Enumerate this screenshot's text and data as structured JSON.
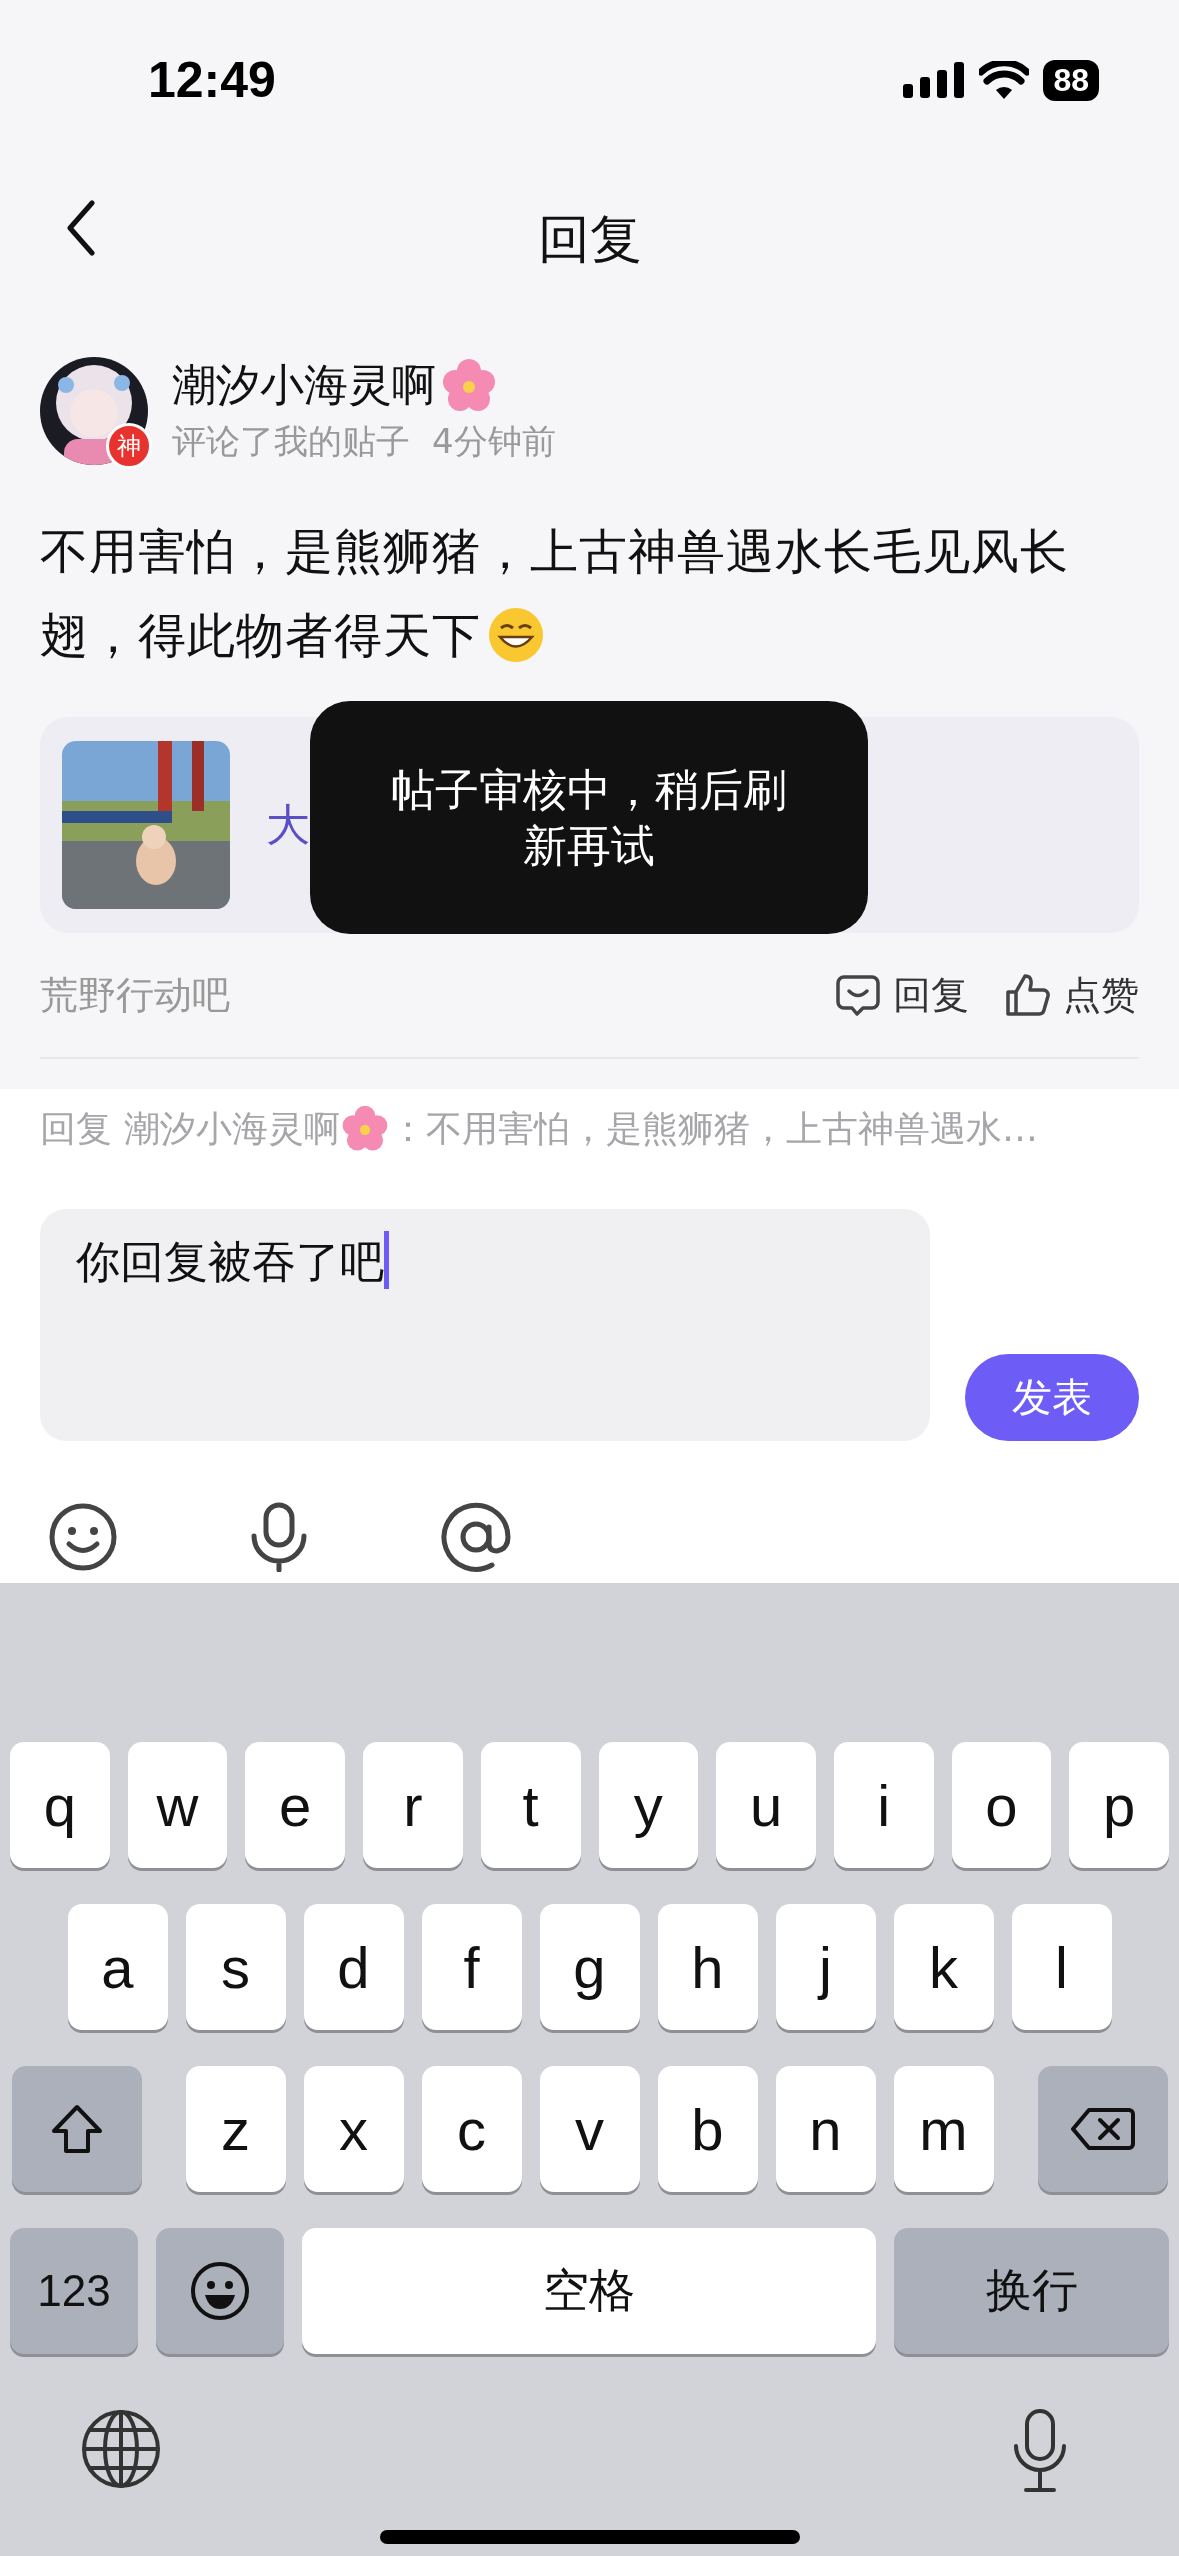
{
  "status_bar": {
    "time": "12:49",
    "battery": "88"
  },
  "header": {
    "title": "回复"
  },
  "comment": {
    "avatar_badge": "神",
    "author": "潮汐小海灵啊",
    "meta": "评论了我的贴子",
    "time": "4分钟前",
    "text_lines": [
      "不用害怕，是熊狮猪，上古神兽遇水长毛见风长",
      "翅，得此物者得天下"
    ]
  },
  "post_card": {
    "title": "大"
  },
  "toast": "帖子审核中，稍后刷新再试",
  "footer": {
    "forum": "荒野行动吧",
    "actions": [
      {
        "kind": "reply",
        "label": "回复"
      },
      {
        "kind": "like",
        "label": "点赞"
      }
    ]
  },
  "reply_to": {
    "prefix": "回复",
    "author": "潮汐小海灵啊",
    "quote": "：不用害怕，是熊狮猪，上古神兽遇水…"
  },
  "composer": {
    "value": "你回复被吞了吧",
    "send": "发表"
  },
  "keyboard": {
    "letter_rows": [
      [
        "q",
        "w",
        "e",
        "r",
        "t",
        "y",
        "u",
        "i",
        "o",
        "p"
      ],
      [
        "a",
        "s",
        "d",
        "f",
        "g",
        "h",
        "j",
        "k",
        "l"
      ],
      [
        "z",
        "x",
        "c",
        "v",
        "b",
        "n",
        "m"
      ]
    ],
    "mode_key": "123",
    "space_key": "空格",
    "return_key": "换行"
  }
}
